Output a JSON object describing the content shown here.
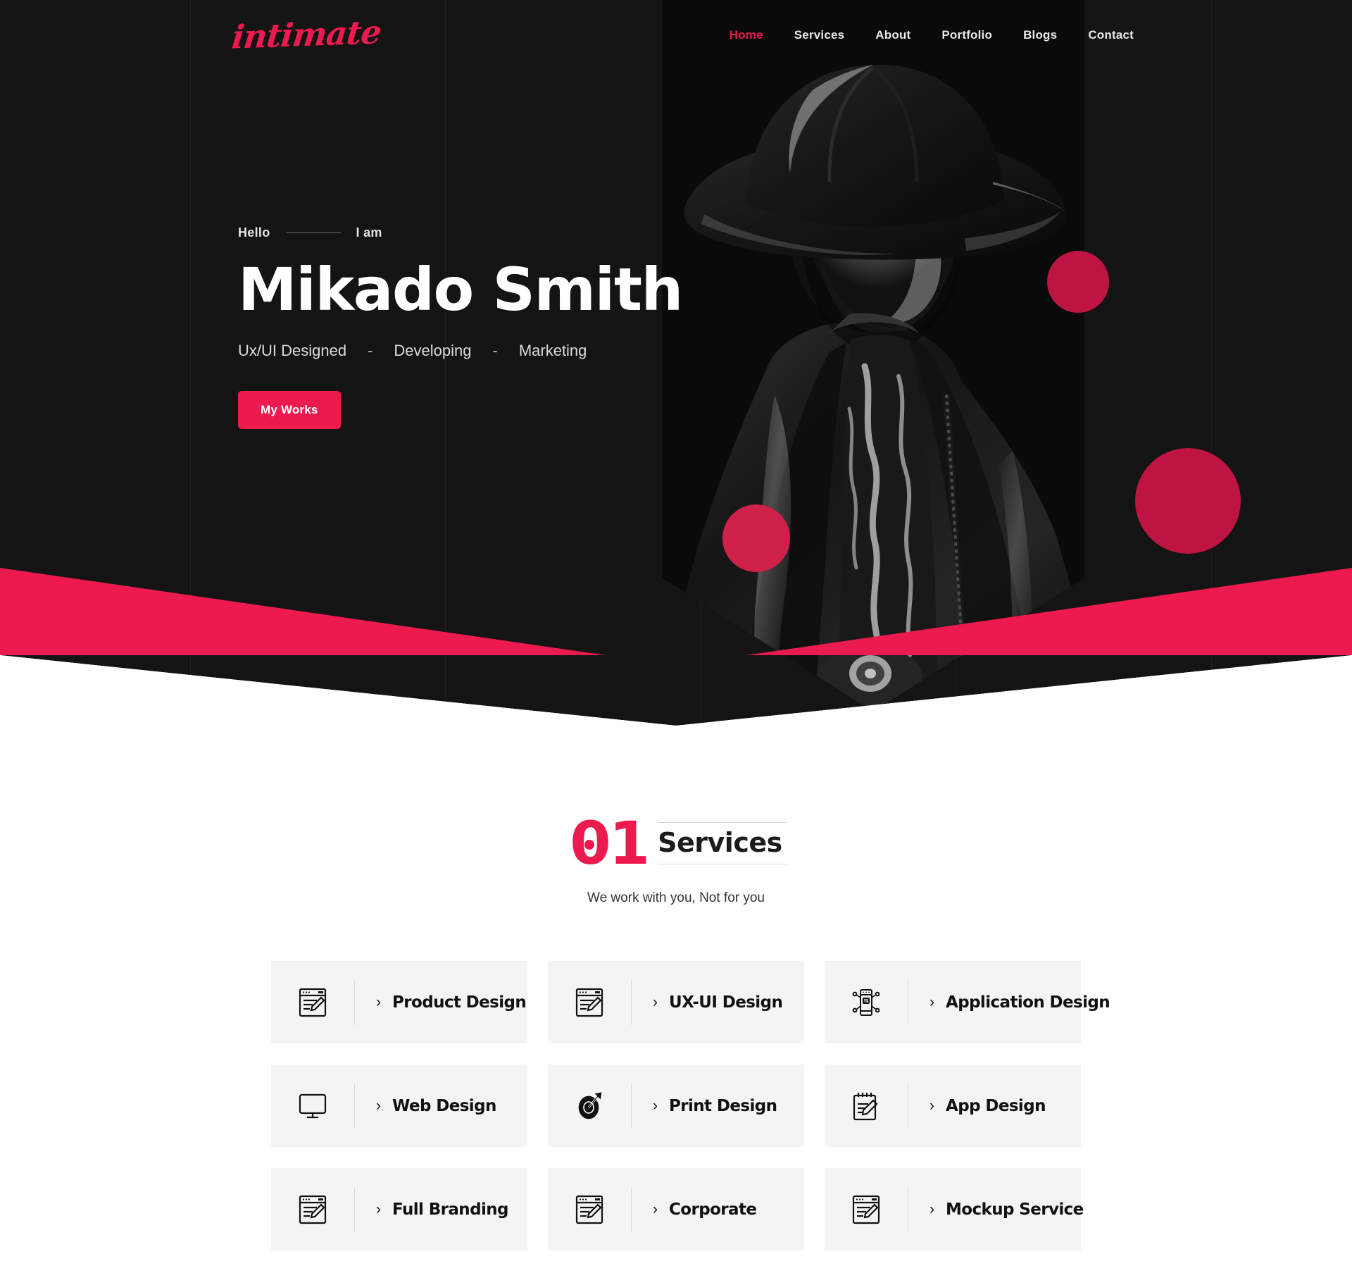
{
  "brand": {
    "logo": "intimate",
    "accent": "#ED1A4F",
    "dark": "#141414",
    "circle_color": "#BE1442"
  },
  "nav": {
    "items": [
      {
        "label": "Home",
        "active": true
      },
      {
        "label": "Services",
        "active": false
      },
      {
        "label": "About",
        "active": false
      },
      {
        "label": "Portfolio",
        "active": false
      },
      {
        "label": "Blogs",
        "active": false
      },
      {
        "label": "Contact",
        "active": false
      }
    ]
  },
  "hero": {
    "greeting": "Hello",
    "i_am": "I am",
    "name": "Mikado Smith",
    "roles": [
      "Ux/UI Designed",
      "Developing",
      "Marketing"
    ],
    "role_separator": "-",
    "cta": "My Works",
    "photo_alt": "man-in-fedora-hat-photo"
  },
  "services": {
    "number": "01",
    "title": "Services",
    "subtitle": "We work with you, Not for you",
    "chevron": "›",
    "cards": [
      {
        "label": "Product Design",
        "icon": "browser-pencil-icon"
      },
      {
        "label": "UX-UI Design",
        "icon": "browser-pencil-icon"
      },
      {
        "label": "Application Design",
        "icon": "mobile-share-icon"
      },
      {
        "label": "Web Design",
        "icon": "monitor-icon"
      },
      {
        "label": "Print Design",
        "icon": "target-dart-icon"
      },
      {
        "label": "App Design",
        "icon": "notepad-pencil-icon"
      },
      {
        "label": "Full Branding",
        "icon": "browser-pencil-icon"
      },
      {
        "label": "Corporate",
        "icon": "browser-pencil-icon"
      },
      {
        "label": "Mockup Service",
        "icon": "browser-pencil-icon"
      }
    ]
  }
}
